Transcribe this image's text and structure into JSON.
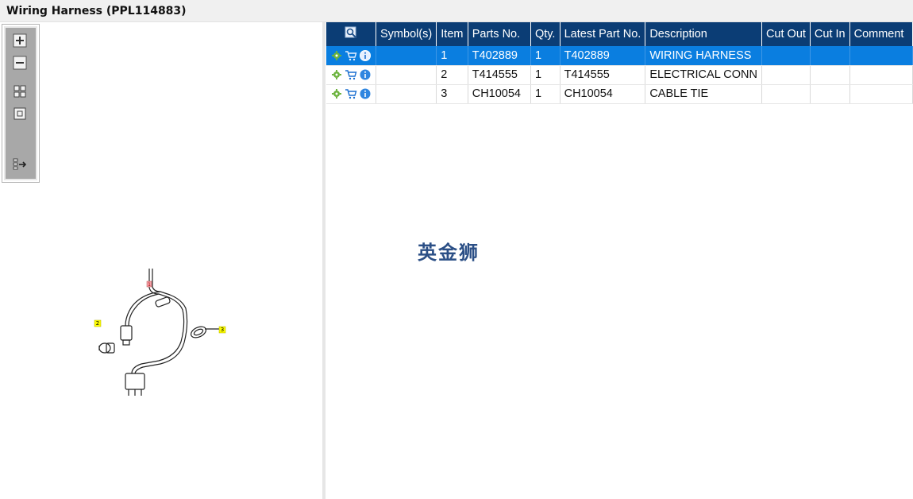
{
  "window": {
    "title": "Wiring Harness (PPL114883)"
  },
  "toolbox": {
    "tools": [
      {
        "name": "zoom-in-icon"
      },
      {
        "name": "zoom-out-icon"
      },
      {
        "name": "fit-all-icon"
      },
      {
        "name": "fit-window-icon"
      },
      {
        "name": "export-icon"
      }
    ]
  },
  "diagram": {
    "callouts": [
      "1",
      "2",
      "3"
    ],
    "colors": {
      "callout_1": "#f4a0a8",
      "callout_2": "#ffff00",
      "callout_3": "#ffff00"
    }
  },
  "table": {
    "columns": [
      "",
      "Symbol(s)",
      "Item",
      "Parts No.",
      "Qty.",
      "Latest Part No.",
      "Description",
      "Cut Out",
      "Cut In",
      "Comment"
    ],
    "rows": [
      {
        "symbols": "",
        "item": "1",
        "parts_no": "T402889",
        "qty": "1",
        "latest": "T402889",
        "description": "WIRING HARNESS",
        "cut_out": "",
        "cut_in": "",
        "comment": ""
      },
      {
        "symbols": "",
        "item": "2",
        "parts_no": "T414555",
        "qty": "1",
        "latest": "T414555",
        "description": "ELECTRICAL CONN",
        "cut_out": "",
        "cut_in": "",
        "comment": ""
      },
      {
        "symbols": "",
        "item": "3",
        "parts_no": "CH10054",
        "qty": "1",
        "latest": "CH10054",
        "description": "CABLE TIE",
        "cut_out": "",
        "cut_in": "",
        "comment": ""
      }
    ],
    "selected_row": 0,
    "colors": {
      "header_bg": "#0b3d75",
      "selected_bg": "#0a7ee0"
    }
  },
  "watermark": "英金狮"
}
